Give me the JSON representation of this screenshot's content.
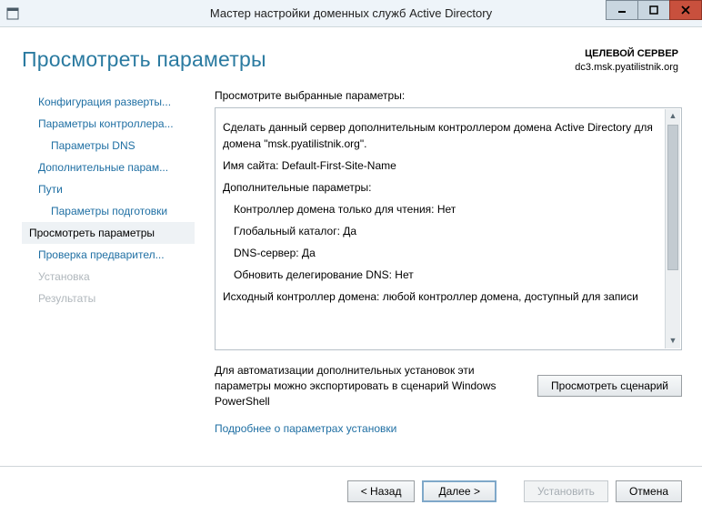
{
  "window": {
    "title": "Мастер настройки доменных служб Active Directory"
  },
  "header": {
    "page_title": "Просмотреть параметры",
    "target_label": "ЦЕЛЕВОЙ СЕРВЕР",
    "target_value": "dc3.msk.pyatilistnik.org"
  },
  "sidebar": {
    "items": [
      {
        "label": "Конфигурация разверты...",
        "indent": false,
        "state": "link"
      },
      {
        "label": "Параметры контроллера...",
        "indent": false,
        "state": "link"
      },
      {
        "label": "Параметры DNS",
        "indent": true,
        "state": "link"
      },
      {
        "label": "Дополнительные парам...",
        "indent": false,
        "state": "link"
      },
      {
        "label": "Пути",
        "indent": false,
        "state": "link"
      },
      {
        "label": "Параметры подготовки",
        "indent": true,
        "state": "link"
      },
      {
        "label": "Просмотреть параметры",
        "indent": false,
        "state": "active"
      },
      {
        "label": "Проверка предварител...",
        "indent": false,
        "state": "link"
      },
      {
        "label": "Установка",
        "indent": false,
        "state": "disabled"
      },
      {
        "label": "Результаты",
        "indent": false,
        "state": "disabled"
      }
    ]
  },
  "main": {
    "instruction": "Просмотрите выбранные параметры:",
    "summary": [
      {
        "text": "Сделать данный сервер дополнительным контроллером домена Active Directory для домена \"msk.pyatilistnik.org\"."
      },
      {
        "text": "Имя сайта: Default-First-Site-Name"
      },
      {
        "text": "Дополнительные параметры:"
      },
      {
        "text": "Контроллер домена только для чтения: Нет",
        "indent": true
      },
      {
        "text": "Глобальный каталог: Да",
        "indent": true
      },
      {
        "text": "DNS-сервер: Да",
        "indent": true
      },
      {
        "text": "Обновить делегирование DNS: Нет",
        "indent": true
      },
      {
        "text": "Исходный контроллер домена: любой контроллер домена, доступный для записи"
      }
    ],
    "export_text": "Для автоматизации дополнительных установок эти параметры можно экспортировать в сценарий Windows PowerShell",
    "view_script_btn": "Просмотреть сценарий",
    "more_link": "Подробнее о параметрах установки"
  },
  "footer": {
    "back": "< Назад",
    "next": "Далее >",
    "install": "Установить",
    "cancel": "Отмена"
  }
}
